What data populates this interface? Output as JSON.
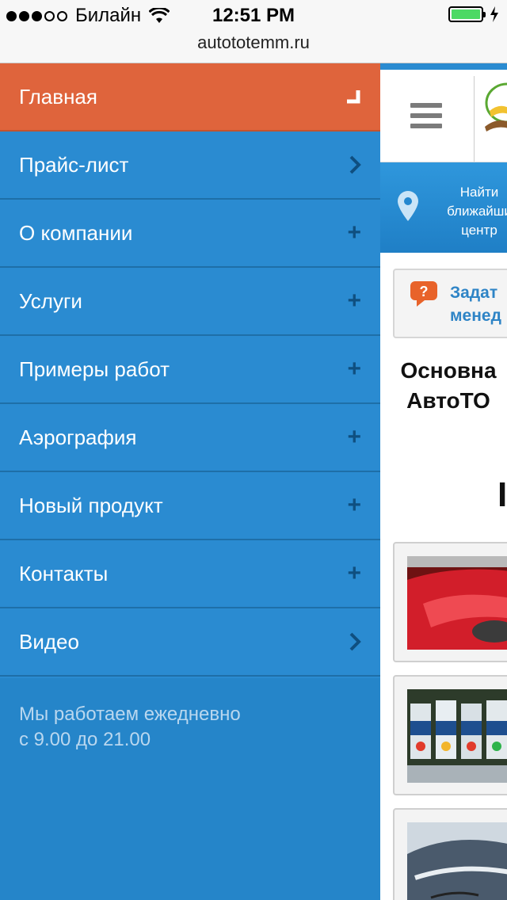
{
  "status_bar": {
    "carrier": "Билайн",
    "time": "12:51 PM"
  },
  "browser": {
    "url": "autototemm.ru"
  },
  "menu": {
    "items": [
      {
        "label": "Главная",
        "icon": "collapse-corner-icon",
        "active": true
      },
      {
        "label": "Прайс-лист",
        "icon": "chevron-right-icon"
      },
      {
        "label": "О компании",
        "icon": "plus-icon"
      },
      {
        "label": "Услуги",
        "icon": "plus-icon"
      },
      {
        "label": "Примеры работ",
        "icon": "plus-icon"
      },
      {
        "label": "Аэрография",
        "icon": "plus-icon"
      },
      {
        "label": "Новый продукт",
        "icon": "plus-icon"
      },
      {
        "label": "Контакты",
        "icon": "plus-icon"
      },
      {
        "label": "Видео",
        "icon": "chevron-right-icon"
      }
    ],
    "hours_line1": "Мы работаем ежедневно",
    "hours_line2": "с 9.00 до 21.00"
  },
  "page": {
    "find_line1": "Найти",
    "find_line2": "ближайши",
    "find_line3": "центр",
    "ask_line1": "Задат",
    "ask_line2": "менед",
    "heading_line1": "Основна",
    "heading_line2": "АвтоТО",
    "big_letter": "I"
  },
  "colors": {
    "menu_bg": "#2a8bd1",
    "menu_active": "#df643c",
    "accent_blue": "#2e84c6"
  }
}
